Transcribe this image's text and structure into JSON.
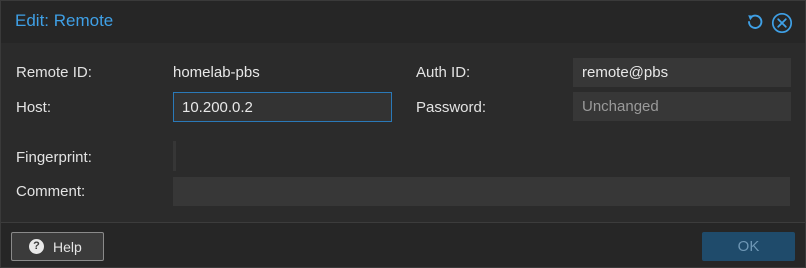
{
  "dialog": {
    "title": "Edit: Remote",
    "tools": {
      "reset_icon": "reset-icon",
      "close_icon": "close-icon"
    }
  },
  "form": {
    "remote_id": {
      "label": "Remote ID:",
      "value": "homelab-pbs"
    },
    "host": {
      "label": "Host:",
      "value": "10.200.0.2"
    },
    "fingerprint": {
      "label": "Fingerprint:"
    },
    "comment": {
      "label": "Comment:",
      "value": ""
    },
    "auth_id": {
      "label": "Auth ID:",
      "value": "remote@pbs"
    },
    "password": {
      "label": "Password:",
      "placeholder": "Unchanged"
    }
  },
  "footer": {
    "help_label": "Help",
    "ok_label": "OK"
  },
  "colors": {
    "accent": "#3fa0e6",
    "focus_border": "#2a79b8",
    "ok_bg": "#1f4b6b"
  }
}
